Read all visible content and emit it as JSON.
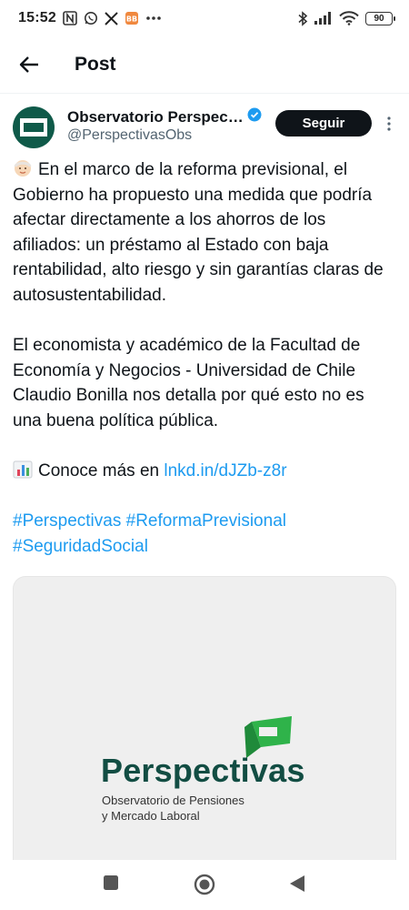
{
  "status_bar": {
    "time": "15:52",
    "battery": "90",
    "left_icons": [
      "n-icon",
      "whatsapp-icon",
      "x-icon",
      "app-icon",
      "more-dots-icon"
    ],
    "right_icons": [
      "bluetooth-icon",
      "signal-icon",
      "wifi-icon",
      "battery-icon"
    ]
  },
  "header": {
    "title": "Post"
  },
  "author": {
    "name": "Observatorio Perspec…",
    "handle": "@PerspectivasObs",
    "verified": true,
    "follow_label": "Seguir"
  },
  "post": {
    "para1": "En el marco de la reforma previsional, el Gobierno ha propuesto una medida que podría afectar directamente a los ahorros de los afiliados: un préstamo al Estado con baja rentabilidad, alto riesgo y sin garantías claras de autosustentabilidad.",
    "para2": "El economista y académico de la Facultad de Economía y Negocios - Universidad de Chile Claudio Bonilla nos detalla por qué esto no es una buena política pública.",
    "para3_prefix": "Conoce más en ",
    "link": "lnkd.in/dJZb-z8r",
    "hashtag1": "#Perspectivas",
    "hashtag2": "#ReformaPrevisional",
    "hashtag3": "#SeguridadSocial"
  },
  "media": {
    "logo_word": "Perspectivas",
    "logo_sub1": "Observatorio de Pensiones",
    "logo_sub2": "y Mercado Laboral"
  },
  "colors": {
    "link": "#1d9bf0",
    "brand_dark": "#124d43",
    "brand_green": "#2fb34a",
    "verified": "#1d9bf0"
  }
}
